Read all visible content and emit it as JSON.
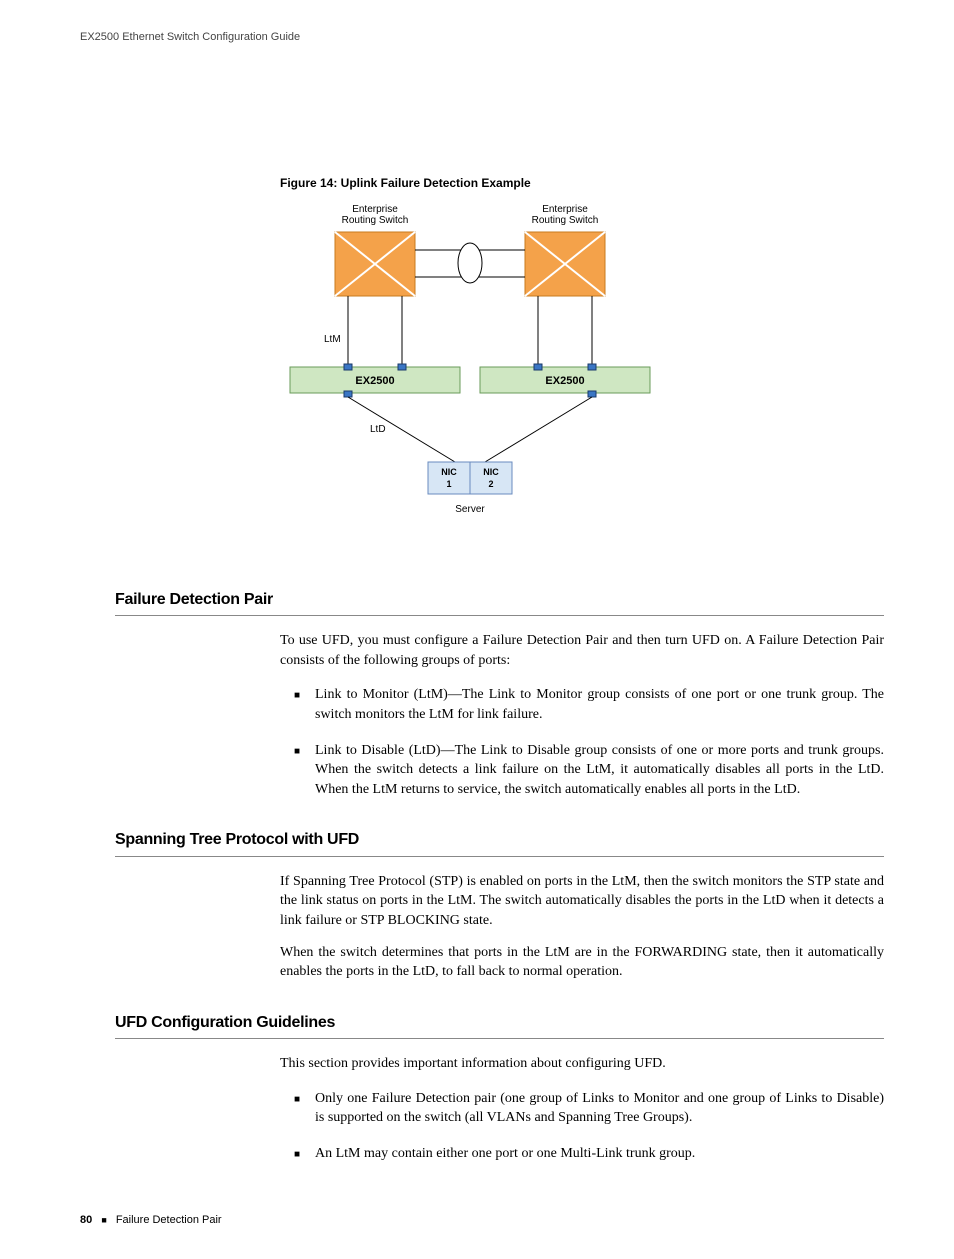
{
  "header": "EX2500 Ethernet Switch Configuration Guide",
  "figure": {
    "caption": "Figure 14:  Uplink Failure Detection Example",
    "label_ent": "Enterprise\nRouting Switch",
    "label_ltm": "LtM",
    "label_ltd": "LtD",
    "label_ex": "EX2500",
    "label_nic1": "NIC\n1",
    "label_nic2": "NIC\n2",
    "label_server": "Server"
  },
  "sections": {
    "fdp": {
      "heading": "Failure Detection Pair",
      "intro": "To use UFD, you must configure a Failure Detection Pair and then turn UFD on. A Failure Detection Pair consists of the following groups of ports:",
      "items": [
        "Link to Monitor (LtM)—The Link to Monitor group consists of one port or one trunk group. The switch monitors the LtM for link failure.",
        "Link to Disable (LtD)—The Link to Disable group consists of one or more ports and trunk groups. When the switch detects a link failure on the LtM, it automatically disables all ports in the LtD. When the LtM returns to service, the switch automatically enables all ports in the LtD."
      ]
    },
    "stp": {
      "heading": "Spanning Tree Protocol with UFD",
      "p1": "If Spanning Tree Protocol (STP) is enabled on ports in the LtM, then the switch monitors the STP state and the link status on ports in the LtM. The switch automatically disables the ports in the LtD when it detects a link failure or STP BLOCKING state.",
      "p2": "When the switch determines that ports in the LtM are in the FORWARDING state, then it automatically enables the ports in the LtD, to fall back to normal operation."
    },
    "guide": {
      "heading": "UFD Configuration Guidelines",
      "intro": "This section provides important information about configuring UFD.",
      "items": [
        "Only one Failure Detection pair (one group of Links to Monitor and one group of Links to Disable) is supported on the switch (all VLANs and Spanning Tree Groups).",
        "An LtM may contain either one port or one Multi-Link trunk group."
      ]
    }
  },
  "footer": {
    "page": "80",
    "section": "Failure Detection Pair"
  }
}
